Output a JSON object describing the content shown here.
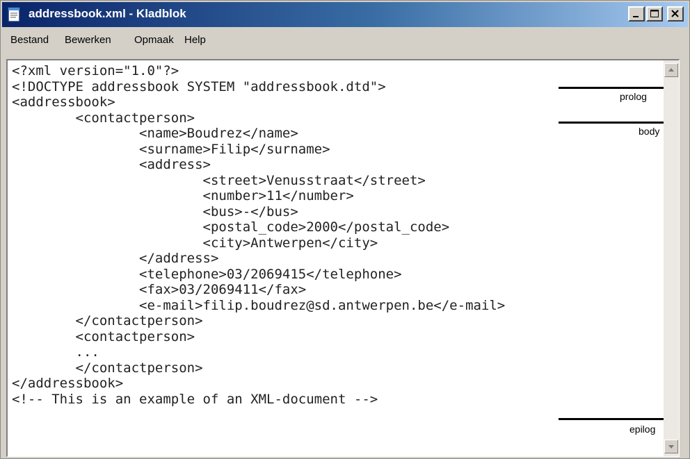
{
  "window": {
    "title": "addressbook.xml - Kladblok"
  },
  "menu": {
    "items": [
      {
        "label": "Bestand"
      },
      {
        "label": "Bewerken"
      },
      {
        "label": "Opmaak"
      },
      {
        "label": "Help"
      }
    ]
  },
  "editor": {
    "lines": [
      "<?xml version=\"1.0\"?>",
      "<!DOCTYPE addressbook SYSTEM \"addressbook.dtd\">",
      "<addressbook>",
      "        <contactperson>",
      "                <name>Boudrez</name>",
      "                <surname>Filip</surname>",
      "                <address>",
      "                        <street>Venusstraat</street>",
      "                        <number>11</number>",
      "                        <bus>-</bus>",
      "                        <postal_code>2000</postal_code>",
      "                        <city>Antwerpen</city>",
      "                </address>",
      "                <telephone>03/2069415</telephone>",
      "                <fax>03/2069411</fax>",
      "                <e-mail>filip.boudrez@sd.antwerpen.be</e-mail>",
      "        </contactperson>",
      "        <contactperson>",
      "        ...",
      "        </contactperson>",
      "</addressbook>",
      "<!-- This is an example of an XML-document -->"
    ]
  },
  "annotations": {
    "prolog": "prolog",
    "body": "body",
    "epilog": "epilog"
  }
}
